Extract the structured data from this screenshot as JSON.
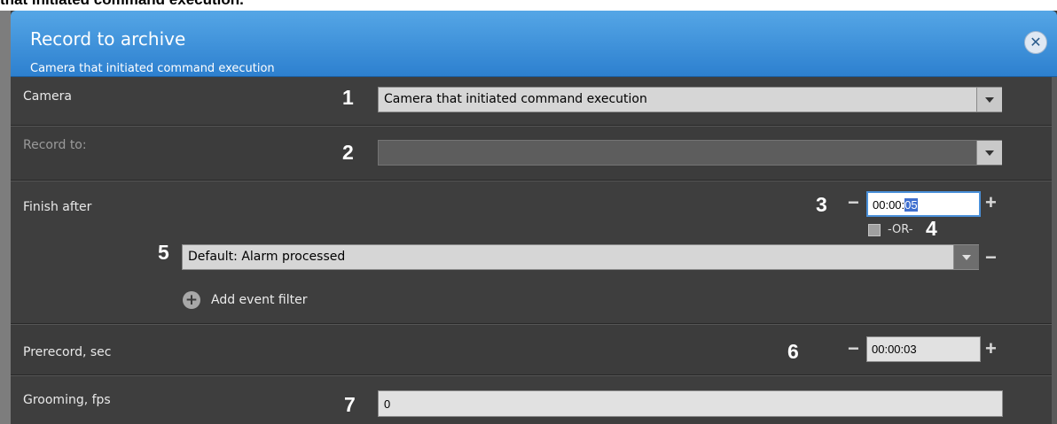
{
  "caption": "that initiated command execution.",
  "dialog": {
    "title": "Record to archive",
    "subtitle": "Camera that initiated command execution",
    "close_symbol": "✕"
  },
  "camera": {
    "label": "Camera",
    "marker": "1",
    "value": "Camera that initiated command execution"
  },
  "record_to": {
    "label": "Record to:",
    "marker": "2",
    "value": ""
  },
  "finish_after": {
    "label": "Finish after",
    "marker": "3",
    "time_prefix": "00:00:",
    "time_selected": "05",
    "minus": "−",
    "plus": "+",
    "or_label": "-OR-",
    "or_marker": "4",
    "event_marker": "5",
    "event_value": "Default: Alarm processed",
    "add_filter_label": "Add event filter",
    "add_icon_symbol": "+"
  },
  "prerecord": {
    "label": "Prerecord, sec",
    "marker": "6",
    "value": "00:00:03",
    "minus": "−",
    "plus": "+"
  },
  "grooming": {
    "label": "Grooming, fps",
    "marker": "7",
    "value": "0"
  },
  "colors": {
    "header_blue": "#3b8fdb",
    "panel_dark": "#3c3c3c",
    "selection": "#3f6fcf"
  },
  "icons": {
    "close": "close-icon",
    "dropdown": "chevron-down-icon",
    "add": "plus-circle-icon"
  }
}
